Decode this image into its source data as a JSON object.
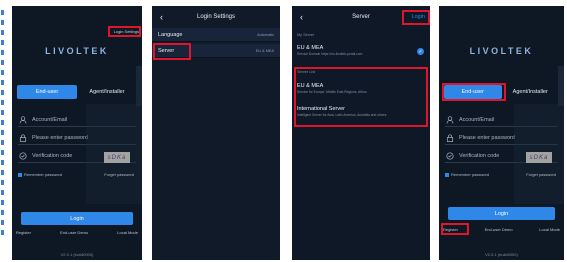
{
  "screen1": {
    "login_settings": "Login Settings",
    "logo": "LIVOLTEK",
    "tab_end_user": "End-user",
    "tab_agent": "Agent/Installer",
    "account_placeholder": "Account/Email",
    "password_placeholder": "Please enter password",
    "verification_placeholder": "Verification code",
    "captcha": "sDKa",
    "remember": "Remember password",
    "forgot": "Forget password",
    "login": "Login",
    "register": "Register",
    "demo": "End-user Demo",
    "local_mode": "Local Mode",
    "version": "V2.0.1 (build0000)"
  },
  "screen2": {
    "title": "Login Settings",
    "rows": [
      {
        "label": "Language",
        "value": "Automatic"
      },
      {
        "label": "Server",
        "value": "EU & MEA"
      }
    ]
  },
  "screen3": {
    "title": "Server",
    "action": "Login",
    "my_server_label": "My Server",
    "current": {
      "name": "EU & MEA",
      "desc": "Service Domain https://eu-livoltek-portal.com"
    },
    "list_label": "Server List",
    "servers": [
      {
        "name": "EU & MEA",
        "desc": "Service for Europe, Middle East Regions, Africa"
      },
      {
        "name": "International Server",
        "desc": "Intelligent Server for Asia, Latin America, Australia and others"
      }
    ]
  },
  "screen4": {
    "logo": "LIVOLTEK",
    "tab_end_user": "End-user",
    "tab_agent": "Agent/Installer",
    "account_placeholder": "Account/Email",
    "password_placeholder": "Please enter password",
    "verification_placeholder": "Verification code",
    "captcha": "sDKa",
    "remember": "Remember password",
    "forgot": "Forget password",
    "login": "Login",
    "register": "Register",
    "demo": "End-user Demo",
    "local_mode": "Local Mode",
    "version": "V2.0.1 (build0000)"
  },
  "colors": {
    "accent": "#2f87e8",
    "highlight": "#e0142a",
    "background": "#0e1724"
  }
}
